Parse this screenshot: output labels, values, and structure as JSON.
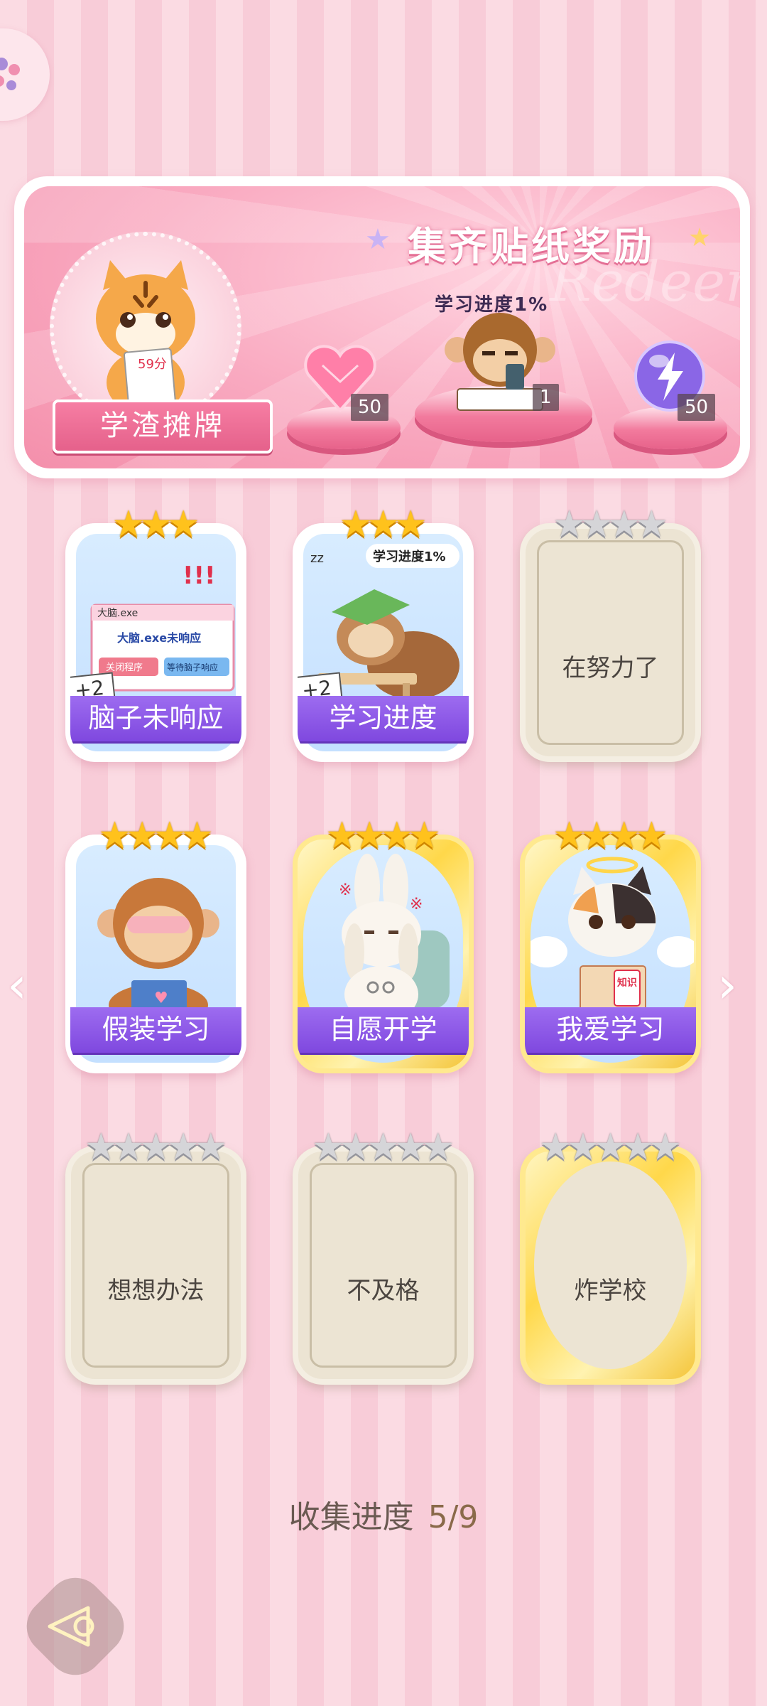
{
  "banner": {
    "title": "集齐贴纸奖励",
    "watermark": "Redeem",
    "character_name": "学渣摊牌",
    "tiger_paper_text": "59分",
    "progress_label": "学习进度1%",
    "rewards": [
      {
        "icon": "heart-gem-icon",
        "count": "50"
      },
      {
        "icon": "monkey-study-icon",
        "count": "1"
      },
      {
        "icon": "lightning-orb-icon",
        "count": "50"
      }
    ]
  },
  "cards": [
    {
      "label": "脑子未响应",
      "stars": 3,
      "star_total": 3,
      "state": "unlocked",
      "badge": "+2",
      "art": "brain-not-responding"
    },
    {
      "label": "学习进度",
      "stars": 3,
      "star_total": 3,
      "state": "unlocked",
      "badge": "+2",
      "art": "sleeping-sloth"
    },
    {
      "label": "在努力了",
      "stars": 0,
      "star_total": 4,
      "state": "locked"
    },
    {
      "label": "假装学习",
      "stars": 4,
      "star_total": 4,
      "state": "unlocked",
      "art": "monkey-reading"
    },
    {
      "label": "自愿开学",
      "stars": 4,
      "star_total": 4,
      "state": "unlocked",
      "art": "bunny-chained"
    },
    {
      "label": "我爱学习",
      "stars": 4,
      "star_total": 4,
      "state": "unlocked",
      "art": "angel-cat"
    },
    {
      "label": "想想办法",
      "stars": 0,
      "star_total": 5,
      "state": "locked"
    },
    {
      "label": "不及格",
      "stars": 0,
      "star_total": 5,
      "state": "locked"
    },
    {
      "label": "炸学校",
      "stars": 0,
      "star_total": 5,
      "state": "locked-gold"
    }
  ],
  "card_art_text": {
    "window_title": "大脑.exe",
    "window_message": "大脑.exe未响应",
    "btn_close": "关闭程序",
    "btn_wait": "等待脑子响应",
    "sloth_bubble": "学习进度1%",
    "book_text": "知识"
  },
  "collection": {
    "label": "收集进度",
    "value": "5/9"
  },
  "colors": {
    "accent_pink": "#f48fab",
    "label_purple": "#8a54e6",
    "star_gold": "#ffc21c"
  }
}
